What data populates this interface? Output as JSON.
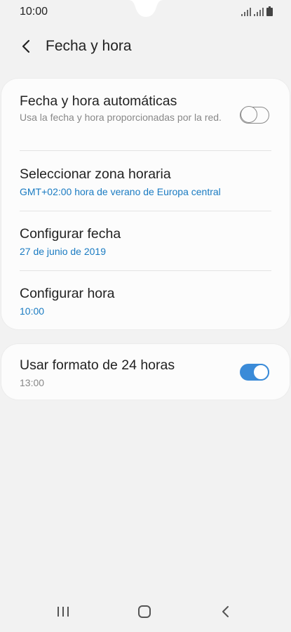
{
  "status_bar": {
    "time": "10:00",
    "icons": [
      "signal-icon",
      "signal-icon",
      "battery-icon"
    ]
  },
  "header": {
    "title": "Fecha y hora",
    "back_icon": "chevron-left-icon"
  },
  "settings": {
    "auto_datetime": {
      "title": "Fecha y hora automáticas",
      "subtitle": "Usa la fecha y hora proporcionadas por la red.",
      "enabled": false
    },
    "timezone": {
      "title": "Seleccionar zona horaria",
      "value": "GMT+02:00 hora de verano de Europa central"
    },
    "set_date": {
      "title": "Configurar fecha",
      "value": "27 de junio de 2019"
    },
    "set_time": {
      "title": "Configurar hora",
      "value": "10:00"
    },
    "format_24h": {
      "title": "Usar formato de 24 horas",
      "value": "13:00",
      "enabled": true
    }
  },
  "colors": {
    "accent": "#3b8bd8",
    "link_text": "#1a7bc2",
    "background": "#f2f2f2",
    "card": "#fcfcfc"
  },
  "nav_bar": {
    "icons": [
      "recent-apps-icon",
      "home-icon",
      "back-icon"
    ]
  }
}
